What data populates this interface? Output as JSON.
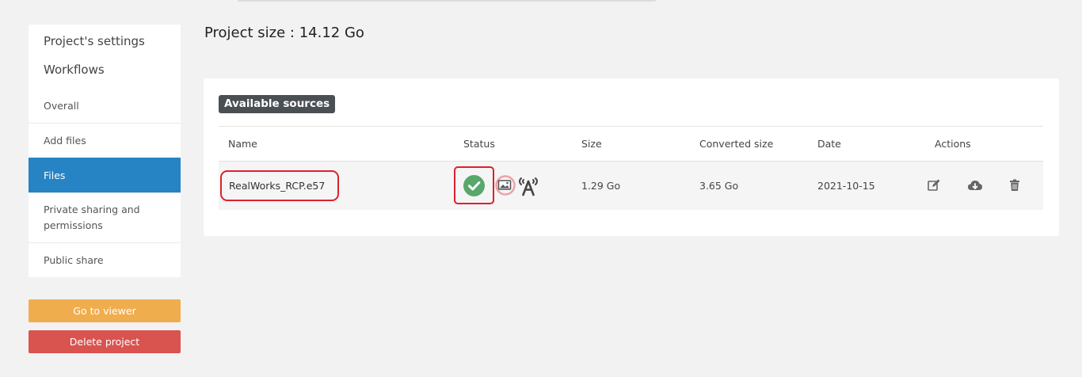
{
  "sidebar": {
    "titles": [
      "Project's settings",
      "Workflows"
    ],
    "items": [
      {
        "label": "Overall"
      },
      {
        "label": "Add files"
      },
      {
        "label": "Files",
        "active": true
      },
      {
        "label": "Private sharing and permissions"
      },
      {
        "label": "Public share"
      }
    ],
    "go_to_viewer": "Go to viewer",
    "delete_project": "Delete project"
  },
  "main": {
    "project_size": "Project size : 14.12 Go",
    "sources_badge": "Available sources",
    "columns": [
      "Name",
      "Status",
      "Size",
      "Converted size",
      "Date",
      "Actions"
    ],
    "rows": [
      {
        "name": "RealWorks_RCP.e57",
        "size": "1.29 Go",
        "converted_size": "3.65 Go",
        "date": "2021-10-15",
        "status_icons": [
          "check-circle-icon",
          "image-icon",
          "antenna-icon"
        ]
      }
    ]
  },
  "colors": {
    "active": "#2683c4",
    "viewer_button": "#f0ad4e",
    "delete_button": "#d9534f",
    "highlight": "#e0202a",
    "success": "#58a86b"
  }
}
